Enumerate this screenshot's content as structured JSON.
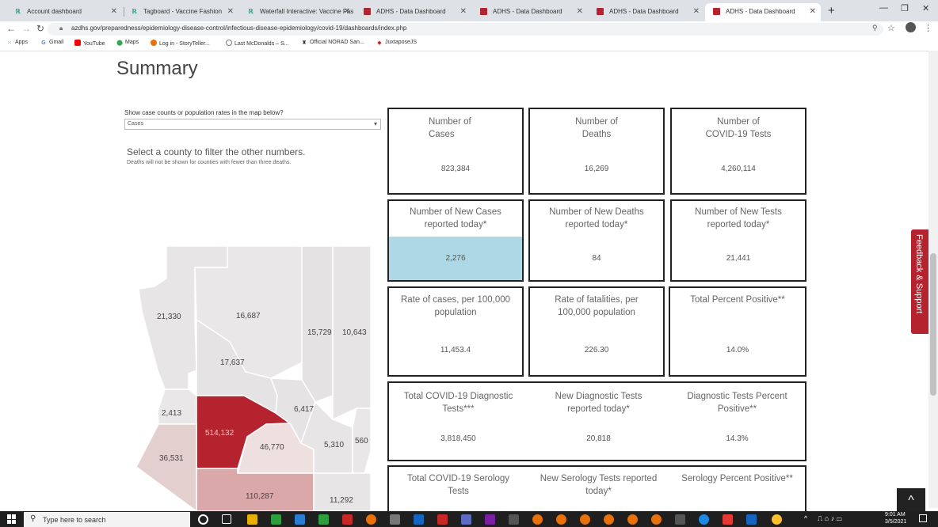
{
  "browser": {
    "tabs": [
      {
        "title": "Account dashboard",
        "favicon": "green"
      },
      {
        "title": "Tagboard - Vaccine Fashion",
        "favicon": "green"
      },
      {
        "title": "Waterfall Interactive: Vaccine Fas",
        "favicon": "green"
      },
      {
        "title": "ADHS - Data Dashboard",
        "favicon": "red"
      },
      {
        "title": "ADHS - Data Dashboard",
        "favicon": "red"
      },
      {
        "title": "ADHS - Data Dashboard",
        "favicon": "red"
      },
      {
        "title": "ADHS - Data Dashboard",
        "favicon": "red",
        "active": true
      }
    ],
    "url": "azdhs.gov/preparedness/epidemiology-disease-control/infectious-disease-epidemiology/covid-19/dashboards/index.php",
    "bookmarks": [
      "Apps",
      "Gmail",
      "YouTube",
      "Maps",
      "Log in - StoryTeller...",
      "Last McDonalds – S...",
      "Official NORAD San...",
      "JuxtaposeJS"
    ]
  },
  "page": {
    "title": "Summary",
    "map_question": "Show case counts or population rates in the map below?",
    "map_select_value": "Cases",
    "select_instruction": "Select a county to filter the other numbers.",
    "deaths_note": "Deaths will not be shown for counties with fewer than three deaths."
  },
  "stats": {
    "cases_label": "Number of Cases",
    "cases_value": "823,384",
    "deaths_label": "Number of Deaths",
    "deaths_value": "16,269",
    "tests_label": "Number of COVID-19 Tests",
    "tests_value": "4,260,114",
    "new_cases_label": "Number of New Cases reported today*",
    "new_cases_value": "2,276",
    "new_deaths_label": "Number of New Deaths reported today*",
    "new_deaths_value": "84",
    "new_tests_label": "Number of New Tests reported today*",
    "new_tests_value": "21,441",
    "case_rate_label": "Rate of cases, per 100,000 population",
    "case_rate_value": "11,453.4",
    "fatality_rate_label": "Rate of fatalities, per 100,000 population",
    "fatality_rate_value": "226.30",
    "pct_positive_label": "Total Percent Positive**",
    "pct_positive_value": "14.0%",
    "diag_tests_label": "Total COVID-19 Diagnostic Tests***",
    "diag_tests_value": "3,818,450",
    "new_diag_label": "New Diagnostic Tests reported today*",
    "new_diag_value": "20,818",
    "diag_pct_label": "Diagnostic Tests Percent Positive**",
    "diag_pct_value": "14.3%",
    "sero_tests_label": "Total COVID-19 Serology Tests",
    "new_sero_label": "New Serology Tests reported today*",
    "sero_pct_label": "Serology Percent Positive**"
  },
  "map_counts": {
    "mohave": "21,330",
    "coconino": "16,687",
    "navajo": "15,729",
    "apache": "10,643",
    "yavapai": "17,637",
    "la_paz": "2,413",
    "maricopa": "514,132",
    "gila": "6,417",
    "pinal": "46,770",
    "graham": "5,310",
    "greenlee": "560",
    "yuma": "36,531",
    "pima": "110,287",
    "cochise": "11,292"
  },
  "feedback_label": "Feedback & Support",
  "scroll_top_label": "^",
  "taskbar": {
    "search_placeholder": "Type here to search",
    "time": "9:01 AM",
    "date": "3/5/2021"
  },
  "colors": {
    "highlight": "#add8e6",
    "maricopa": "#b5232f",
    "pima": "#dba8aa",
    "feedback": "#b5232f"
  }
}
